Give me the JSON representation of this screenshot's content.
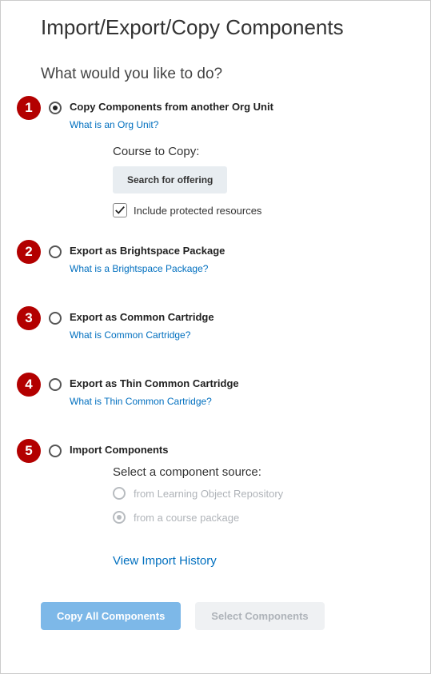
{
  "page_title": "Import/Export/Copy Components",
  "subtitle": "What would you like to do?",
  "options": [
    {
      "badge": "1",
      "label": "Copy Components from another Org Unit",
      "help": "What is an Org Unit?",
      "selected": true,
      "copy_section": {
        "heading": "Course to Copy:",
        "search_button": "Search for offering",
        "checkbox_label": "Include protected resources",
        "checkbox_checked": true
      }
    },
    {
      "badge": "2",
      "label": "Export as Brightspace Package",
      "help": "What is a Brightspace Package?",
      "selected": false
    },
    {
      "badge": "3",
      "label": "Export as Common Cartridge",
      "help": "What is Common Cartridge?",
      "selected": false
    },
    {
      "badge": "4",
      "label": "Export as Thin Common Cartridge",
      "help": "What is Thin Common Cartridge?",
      "selected": false
    },
    {
      "badge": "5",
      "label": "Import Components",
      "help": "",
      "selected": false,
      "import_section": {
        "heading": "Select a component source:",
        "sources": [
          {
            "label": "from Learning Object Repository",
            "selected": false
          },
          {
            "label": "from a course package",
            "selected": true
          }
        ],
        "history_link": "View Import History"
      }
    }
  ],
  "buttons": {
    "primary": "Copy All Components",
    "secondary": "Select Components"
  }
}
